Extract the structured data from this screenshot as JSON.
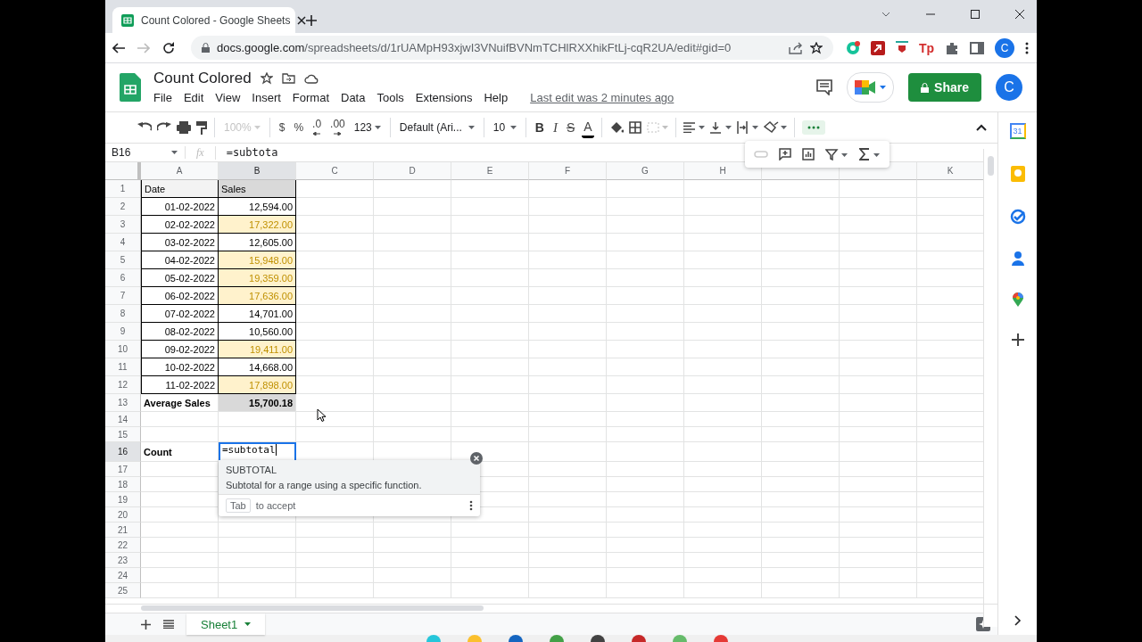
{
  "browser": {
    "tab_title": "Count Colored - Google Sheets",
    "url_host": "docs.google.com",
    "url_path": "/spreadsheets/d/1rUAMpH93xjwI3VNuifBVNmTCHlRXXhikFtLj-cqR2UA/edit#gid=0",
    "extensions": [
      {
        "kind": "grammar"
      },
      {
        "kind": "pdf"
      },
      {
        "kind": "shield"
      },
      {
        "kind": "text",
        "label": "Tp"
      },
      {
        "kind": "puzzle"
      },
      {
        "kind": "sidebar"
      }
    ],
    "profile_initial": "C"
  },
  "doc": {
    "title": "Count Colored",
    "menu": [
      "File",
      "Edit",
      "View",
      "Insert",
      "Format",
      "Data",
      "Tools",
      "Extensions",
      "Help"
    ],
    "last_edit": "Last edit was 2 minutes ago",
    "share_label": "Share",
    "account_initial": "C"
  },
  "toolbar": [
    [
      {
        "kind": "undo"
      },
      {
        "kind": "redo"
      },
      {
        "kind": "print"
      },
      {
        "kind": "paint-format"
      }
    ],
    [
      {
        "kind": "dropdown",
        "label": "100%",
        "disabled": true
      }
    ],
    [
      {
        "kind": "text",
        "label": "$"
      },
      {
        "kind": "text",
        "label": "%"
      },
      {
        "kind": "decimal-decrease",
        "label": ".0"
      },
      {
        "kind": "decimal-increase",
        "label": ".00"
      },
      {
        "kind": "dropdown",
        "label": "123",
        "disabled": false
      }
    ],
    [
      {
        "kind": "dropdown",
        "label": "Default (Ari...",
        "disabled": false
      }
    ],
    [
      {
        "kind": "dropdown",
        "label": "10",
        "disabled": false
      }
    ],
    [
      {
        "kind": "bold",
        "label": "B"
      },
      {
        "kind": "italic",
        "label": "I"
      },
      {
        "kind": "strike",
        "label": "S"
      },
      {
        "kind": "text-color",
        "label": "A"
      }
    ],
    [
      {
        "kind": "fill"
      },
      {
        "kind": "borders"
      },
      {
        "kind": "merge",
        "disabled": true
      }
    ],
    [
      {
        "kind": "align"
      },
      {
        "kind": "valign"
      },
      {
        "kind": "wrap"
      },
      {
        "kind": "rotate"
      }
    ],
    [
      {
        "kind": "more",
        "selected": true
      }
    ]
  ],
  "floating_toolbar": [
    {
      "kind": "link",
      "disabled": true
    },
    {
      "kind": "comment"
    },
    {
      "kind": "chart"
    },
    {
      "kind": "filter"
    },
    {
      "kind": "sum"
    }
  ],
  "formula_bar": {
    "name_box": "B16",
    "fx_label": "fx",
    "formula": "=subtota"
  },
  "sheet": {
    "columns": [
      {
        "label": "A",
        "selected": false
      },
      {
        "label": "B",
        "selected": true
      },
      {
        "label": "C",
        "selected": false
      },
      {
        "label": "D",
        "selected": false
      },
      {
        "label": "E",
        "selected": false
      },
      {
        "label": "F",
        "selected": false
      },
      {
        "label": "G",
        "selected": false
      },
      {
        "label": "H",
        "selected": false
      },
      {},
      {},
      {
        "label": "K",
        "selected": false
      }
    ],
    "rows": [
      {
        "number": "1",
        "selected": false,
        "cells": [
          {
            "kind": "header",
            "text": "Date"
          },
          {
            "kind": "header-dark",
            "text": "Sales"
          }
        ]
      },
      {
        "number": "2",
        "selected": false,
        "cells": [
          {
            "kind": "date",
            "text": "01-02-2022"
          },
          {
            "kind": "amount",
            "text": "12,594.00",
            "highlighted": false
          }
        ]
      },
      {
        "number": "3",
        "selected": false,
        "cells": [
          {
            "kind": "date",
            "text": "02-02-2022"
          },
          {
            "kind": "amount",
            "text": "17,322.00",
            "highlighted": true
          }
        ]
      },
      {
        "number": "4",
        "selected": false,
        "cells": [
          {
            "kind": "date",
            "text": "03-02-2022"
          },
          {
            "kind": "amount",
            "text": "12,605.00",
            "highlighted": false
          }
        ]
      },
      {
        "number": "5",
        "selected": false,
        "cells": [
          {
            "kind": "date",
            "text": "04-02-2022"
          },
          {
            "kind": "amount",
            "text": "15,948.00",
            "highlighted": true
          }
        ]
      },
      {
        "number": "6",
        "selected": false,
        "cells": [
          {
            "kind": "date",
            "text": "05-02-2022"
          },
          {
            "kind": "amount",
            "text": "19,359.00",
            "highlighted": true
          }
        ]
      },
      {
        "number": "7",
        "selected": false,
        "cells": [
          {
            "kind": "date",
            "text": "06-02-2022"
          },
          {
            "kind": "amount",
            "text": "17,636.00",
            "highlighted": true
          }
        ]
      },
      {
        "number": "8",
        "selected": false,
        "cells": [
          {
            "kind": "date",
            "text": "07-02-2022"
          },
          {
            "kind": "amount",
            "text": "14,701.00",
            "highlighted": false
          }
        ]
      },
      {
        "number": "9",
        "selected": false,
        "cells": [
          {
            "kind": "date",
            "text": "08-02-2022"
          },
          {
            "kind": "amount",
            "text": "10,560.00",
            "highlighted": false
          }
        ]
      },
      {
        "number": "10",
        "selected": false,
        "cells": [
          {
            "kind": "date",
            "text": "09-02-2022"
          },
          {
            "kind": "amount",
            "text": "19,411.00",
            "highlighted": true
          }
        ]
      },
      {
        "number": "11",
        "selected": false,
        "cells": [
          {
            "kind": "date",
            "text": "10-02-2022"
          },
          {
            "kind": "amount",
            "text": "14,668.00",
            "highlighted": false
          }
        ]
      },
      {
        "number": "12",
        "selected": false,
        "cells": [
          {
            "kind": "date",
            "text": "11-02-2022"
          },
          {
            "kind": "amount",
            "text": "17,898.00",
            "highlighted": true
          }
        ]
      },
      {
        "number": "13",
        "selected": false,
        "cells": [
          {
            "kind": "total-label",
            "text": "Average Sales"
          },
          {
            "kind": "total-value",
            "text": "15,700.18"
          }
        ]
      },
      {
        "number": "14",
        "selected": false,
        "cells": []
      },
      {
        "number": "15",
        "selected": false,
        "cells": []
      },
      {
        "number": "16",
        "selected": true,
        "cells": [
          {
            "kind": "total-label",
            "text": "Count"
          },
          {
            "kind": "editing",
            "text": "=subtotal"
          }
        ]
      },
      {
        "number": "17",
        "selected": false,
        "cells": []
      },
      {
        "number": "18",
        "selected": false,
        "cells": []
      },
      {
        "number": "19",
        "selected": false,
        "cells": []
      },
      {
        "number": "20",
        "selected": false,
        "cells": []
      },
      {
        "number": "21",
        "selected": false,
        "cells": []
      },
      {
        "number": "22",
        "selected": false,
        "cells": []
      },
      {
        "number": "23",
        "selected": false,
        "cells": []
      },
      {
        "number": "24",
        "selected": false,
        "cells": []
      },
      {
        "number": "25",
        "selected": false,
        "cells": []
      }
    ]
  },
  "autocomplete": {
    "function": "SUBTOTAL",
    "description": "Subtotal for a range using a specific function.",
    "key": "Tab",
    "hint": "to accept"
  },
  "side_panel": [
    {
      "kind": "calendar",
      "label": "31"
    },
    {
      "kind": "keep"
    },
    {
      "kind": "tasks"
    },
    {
      "kind": "contacts"
    },
    {
      "kind": "maps"
    },
    {
      "kind": "add"
    }
  ],
  "sheet_tabs": [
    {
      "label": "Sheet1",
      "selected": true
    }
  ]
}
